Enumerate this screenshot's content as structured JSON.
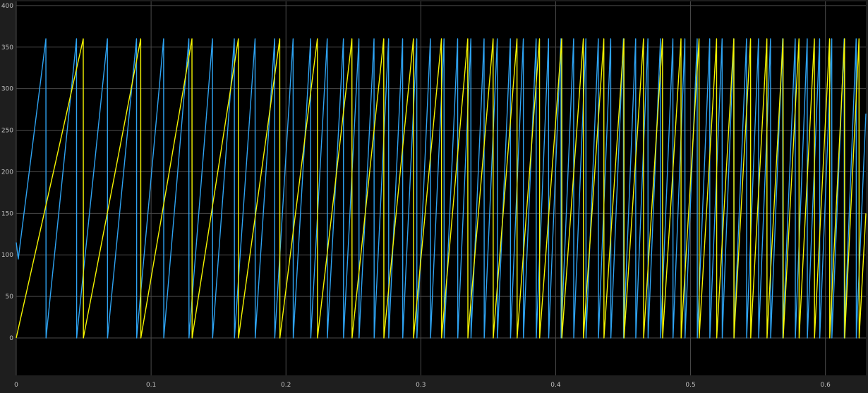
{
  "chart_data": {
    "type": "line",
    "title": "",
    "xlabel": "",
    "ylabel": "",
    "xlim": [
      0,
      0.63
    ],
    "ylim": [
      -45,
      405
    ],
    "grid": true,
    "legend": "none",
    "x_ticks": [
      0,
      0.1,
      0.2,
      0.3,
      0.4,
      0.5,
      0.6
    ],
    "x_tick_labels": [
      "0",
      "0.1",
      "0.2",
      "0.3",
      "0.4",
      "0.5",
      "0.6"
    ],
    "y_ticks": [
      0,
      50,
      100,
      150,
      200,
      250,
      300,
      350,
      400
    ],
    "y_tick_labels": [
      "0",
      "50",
      "100",
      "150",
      "200",
      "250",
      "300",
      "350",
      "400"
    ],
    "background_color": "#000000",
    "frame_color": "#1e1e1e",
    "grid_color": "#4a4a4a",
    "tick_label_color": "#bfbfbf",
    "series": [
      {
        "color": "#2ea3f2",
        "x": [
          0,
          0.0015,
          0.022,
          0.0221,
          0.0447,
          0.0448,
          0.0676,
          0.0677,
          0.0892,
          0.0893,
          0.1093,
          0.1094,
          0.128,
          0.1281,
          0.1455,
          0.1456,
          0.1617,
          0.1618,
          0.1771,
          0.1772,
          0.1916,
          0.1917,
          0.2053,
          0.2054,
          0.2183,
          0.2184,
          0.2306,
          0.2307,
          0.2426,
          0.2427,
          0.2541,
          0.2542,
          0.2653,
          0.2654,
          0.2761,
          0.2762,
          0.2865,
          0.2866,
          0.297,
          0.2971,
          0.3071,
          0.3072,
          0.3172,
          0.3173,
          0.3273,
          0.3274,
          0.3371,
          0.3372,
          0.3469,
          0.347,
          0.3567,
          0.3568,
          0.3664,
          0.3665,
          0.376,
          0.3761,
          0.3855,
          0.3856,
          0.3947,
          0.3948,
          0.4039,
          0.404,
          0.4133,
          0.4134,
          0.4224,
          0.4225,
          0.4316,
          0.4317,
          0.4408,
          0.4409,
          0.4502,
          0.4503,
          0.4593,
          0.4594,
          0.4684,
          0.4685,
          0.4777,
          0.4778,
          0.4869,
          0.487,
          0.4958,
          0.4959,
          0.5049,
          0.505,
          0.5142,
          0.5143,
          0.5234,
          0.5235,
          0.5321,
          0.5322,
          0.5415,
          0.5416,
          0.5504,
          0.5505,
          0.5593,
          0.5594,
          0.5683,
          0.5684,
          0.5776,
          0.5777,
          0.5865,
          0.5866,
          0.5957,
          0.5958,
          0.6047,
          0.6048,
          0.6139,
          0.614,
          0.6228,
          0.6229,
          0.63
        ],
        "y": [
          115,
          95,
          360,
          0,
          360,
          0,
          360,
          0,
          360,
          0,
          360,
          0,
          360,
          0,
          360,
          0,
          360,
          0,
          360,
          0,
          360,
          0,
          360,
          0,
          360,
          0,
          360,
          0,
          360,
          0,
          360,
          0,
          360,
          0,
          360,
          0,
          360,
          0,
          360,
          0,
          360,
          0,
          360,
          0,
          360,
          0,
          360,
          0,
          360,
          0,
          360,
          0,
          360,
          0,
          360,
          0,
          360,
          0,
          360,
          0,
          360,
          0,
          360,
          0,
          360,
          0,
          360,
          0,
          360,
          0,
          360,
          0,
          360,
          0,
          360,
          0,
          360,
          0,
          360,
          0,
          360,
          0,
          360,
          0,
          360,
          0,
          360,
          0,
          360,
          0,
          360,
          0,
          360,
          0,
          360,
          0,
          360,
          0,
          360,
          0,
          360,
          0,
          360,
          0,
          360,
          0,
          360,
          0,
          360,
          0,
          270
        ]
      },
      {
        "color": "#f5f500",
        "x": [
          0,
          0.0497,
          0.0498,
          0.0923,
          0.0924,
          0.1303,
          0.1304,
          0.1647,
          0.1648,
          0.1954,
          0.1955,
          0.2233,
          0.2234,
          0.2489,
          0.249,
          0.2725,
          0.2726,
          0.2945,
          0.2946,
          0.3153,
          0.3154,
          0.3348,
          0.3349,
          0.3536,
          0.3537,
          0.3713,
          0.3714,
          0.388,
          0.3881,
          0.4045,
          0.4046,
          0.4205,
          0.4206,
          0.4357,
          0.4358,
          0.4506,
          0.4507,
          0.4651,
          0.4652,
          0.4792,
          0.4793,
          0.4929,
          0.493,
          0.5063,
          0.5064,
          0.5193,
          0.5194,
          0.5321,
          0.5322,
          0.5445,
          0.5446,
          0.5566,
          0.5567,
          0.5686,
          0.5687,
          0.5804,
          0.5805,
          0.5918,
          0.5919,
          0.6031,
          0.6032,
          0.6142,
          0.6143,
          0.6249,
          0.625,
          0.63
        ],
        "y": [
          0,
          360,
          0,
          360,
          0,
          360,
          0,
          360,
          0,
          360,
          0,
          360,
          0,
          360,
          0,
          360,
          0,
          360,
          0,
          360,
          0,
          360,
          0,
          360,
          0,
          360,
          0,
          360,
          0,
          360,
          0,
          360,
          0,
          360,
          0,
          360,
          0,
          360,
          0,
          360,
          0,
          360,
          0,
          360,
          0,
          360,
          0,
          360,
          0,
          360,
          0,
          360,
          0,
          360,
          0,
          360,
          0,
          360,
          0,
          360,
          0,
          360,
          0,
          360,
          0,
          150
        ]
      }
    ]
  }
}
